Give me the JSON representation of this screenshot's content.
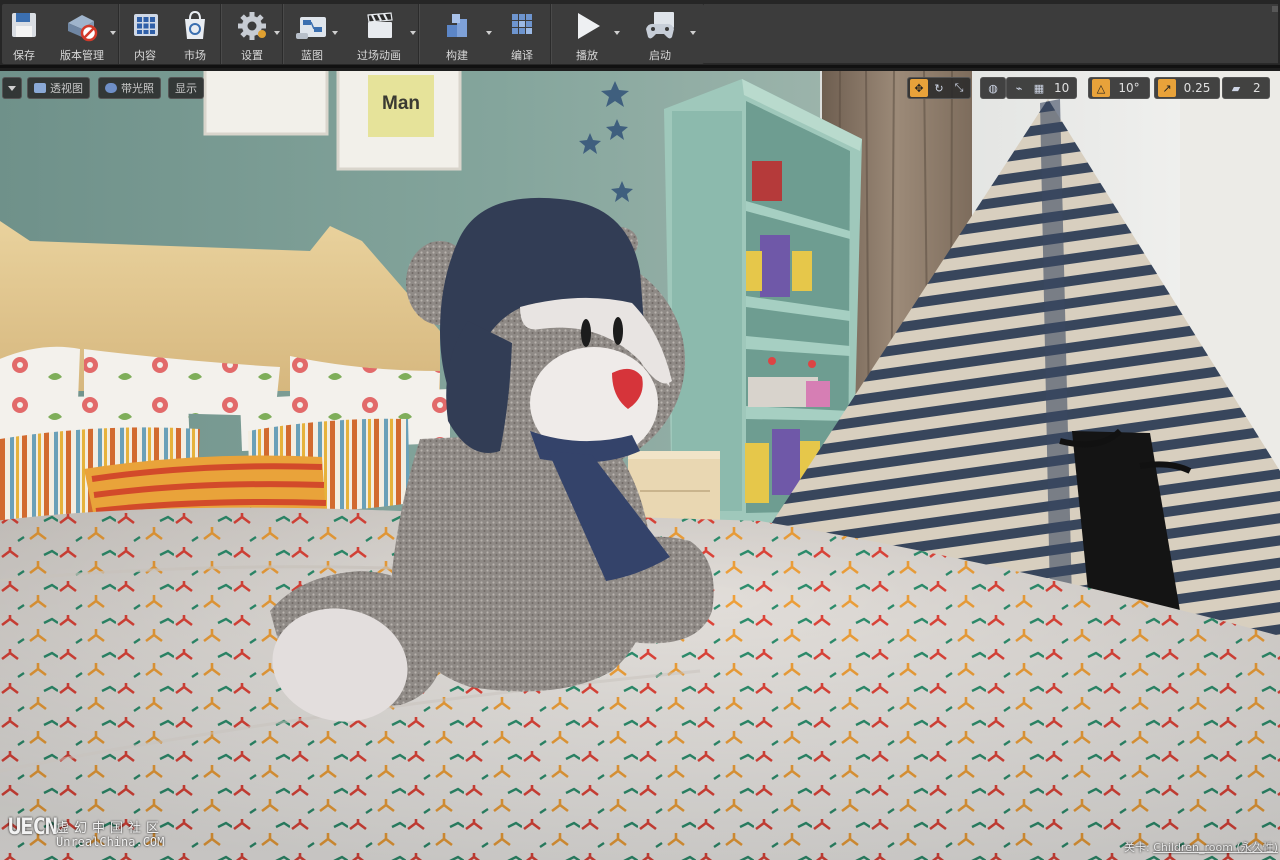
{
  "toolbar": {
    "buttons": [
      {
        "label": "保存",
        "icon": "save-icon"
      },
      {
        "label": "版本管理",
        "icon": "source-control-icon"
      },
      {
        "label": "内容",
        "icon": "content-browser-icon"
      },
      {
        "label": "市场",
        "icon": "marketplace-icon"
      },
      {
        "label": "设置",
        "icon": "settings-gear-icon"
      },
      {
        "label": "蓝图",
        "icon": "blueprint-icon"
      },
      {
        "label": "过场动画",
        "icon": "clapperboard-icon"
      },
      {
        "label": "构建",
        "icon": "build-blocks-icon"
      },
      {
        "label": "编译",
        "icon": "compile-icon"
      },
      {
        "label": "播放",
        "icon": "play-icon"
      },
      {
        "label": "启动",
        "icon": "launch-gamepad-icon"
      }
    ]
  },
  "viewport": {
    "left_controls": {
      "view_mode": "透视图",
      "lighting_mode": "带光照",
      "show": "显示"
    },
    "right_controls": {
      "grid_snap_value": "10",
      "rotation_snap_value": "10°",
      "scale_snap_value": "0.25",
      "camera_speed_value": "2"
    },
    "scene": {
      "wall_frame_text": "Man"
    }
  },
  "watermark": {
    "logo": "UECN",
    "chinese": "虚幻中国社区",
    "english": "UnrealChina.COM"
  },
  "level": {
    "prefix": "关卡:",
    "name": "Children_room (永久性)"
  },
  "colors": {
    "toolbar_bg": "#3c3c3c",
    "snap_active": "#e8a23a",
    "wall": "#7d9e95"
  }
}
